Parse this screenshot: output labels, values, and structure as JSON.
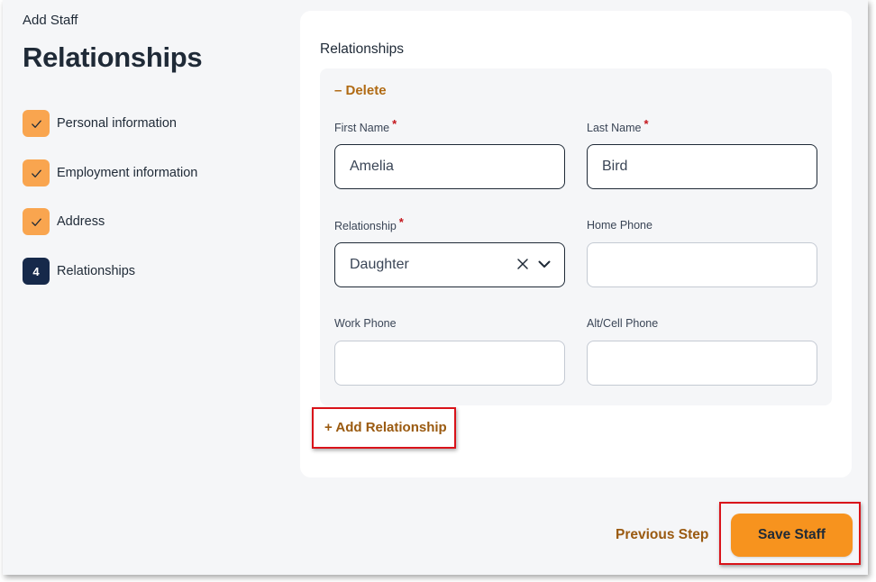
{
  "header": {
    "subtitle": "Add Staff",
    "title": "Relationships"
  },
  "steps": [
    {
      "label": "Personal information",
      "state": "done"
    },
    {
      "label": "Employment information",
      "state": "done"
    },
    {
      "label": "Address",
      "state": "done"
    },
    {
      "label": "Relationships",
      "state": "current",
      "number": "4"
    }
  ],
  "card": {
    "title": "Relationships",
    "delete_label": "– Delete",
    "fields": {
      "first_name": {
        "label": "First Name",
        "required": "*",
        "value": "Amelia"
      },
      "last_name": {
        "label": "Last Name",
        "required": "*",
        "value": "Bird"
      },
      "relationship": {
        "label": "Relationship",
        "required": "*",
        "value": "Daughter"
      },
      "home_phone": {
        "label": "Home Phone",
        "value": ""
      },
      "work_phone": {
        "label": "Work Phone",
        "value": ""
      },
      "alt_cell_phone": {
        "label": "Alt/Cell Phone",
        "value": ""
      }
    },
    "add_relationship_label": "+ Add Relationship"
  },
  "footer": {
    "previous_label": "Previous Step",
    "save_label": "Save Staff"
  },
  "colors": {
    "accent_orange": "#f7931e",
    "step_done": "#f9a54f",
    "step_current": "#16294a",
    "link_brown": "#9a5a10",
    "highlight_red": "#d9131a"
  },
  "icons": [
    "check-icon",
    "clear-x-icon",
    "chevron-down-icon"
  ]
}
